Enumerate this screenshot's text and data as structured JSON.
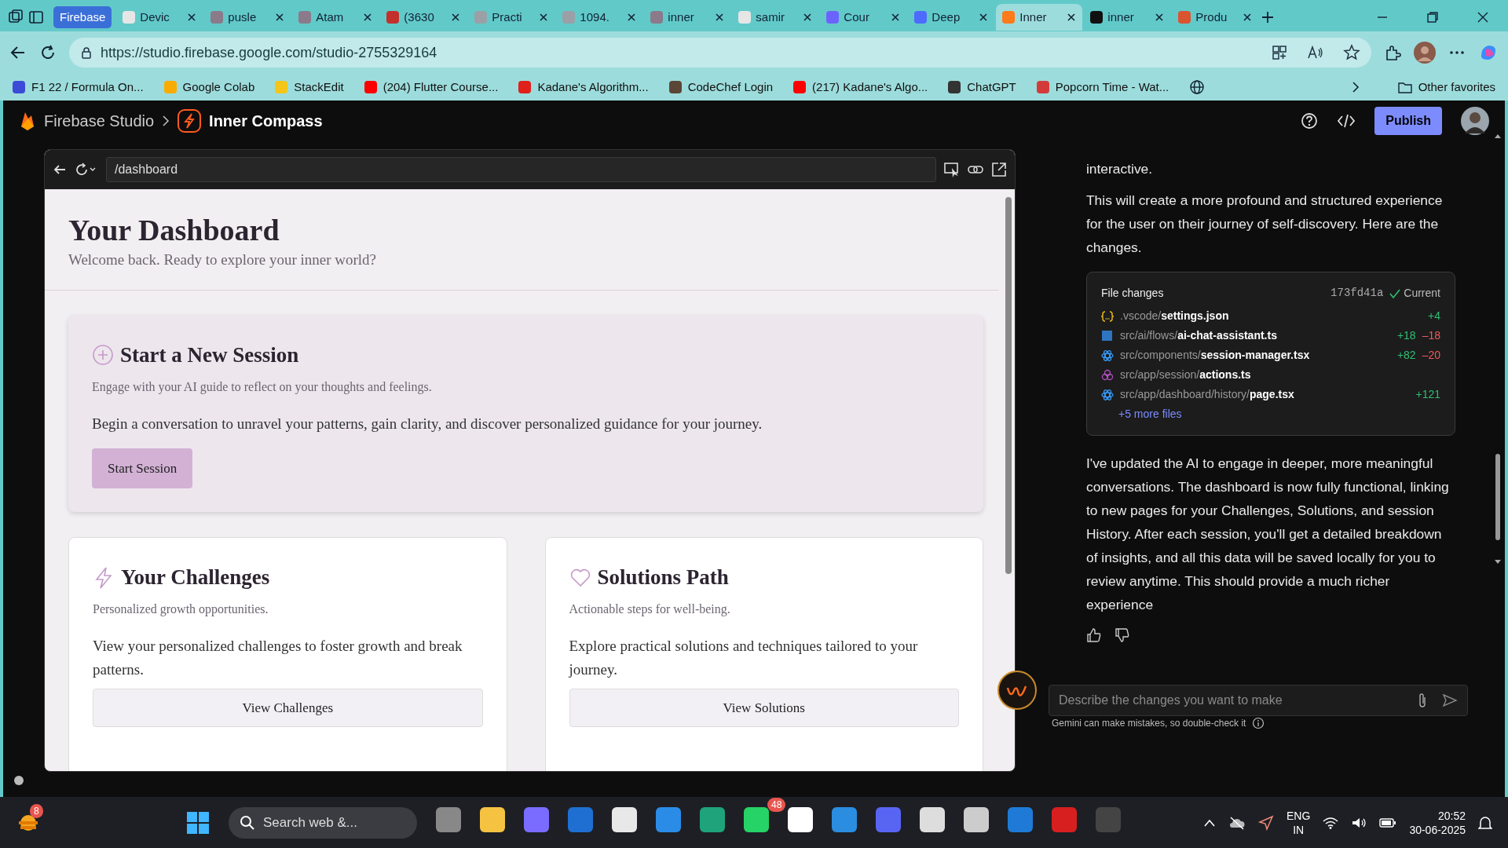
{
  "browser": {
    "tab_group": "Firebase",
    "tabs": [
      {
        "label": "Devic",
        "color": "#e6e6e6",
        "selected": false
      },
      {
        "label": "pusle",
        "color": "#8a7a8a",
        "selected": false
      },
      {
        "label": "Atam",
        "color": "#8a7a8a",
        "selected": false
      },
      {
        "label": "(3630",
        "color": "#c4302b",
        "selected": false
      },
      {
        "label": "Practi",
        "color": "#9aa0a6",
        "selected": false
      },
      {
        "label": "1094.",
        "color": "#9aa0a6",
        "selected": false
      },
      {
        "label": "inner",
        "color": "#8a7a8a",
        "selected": false
      },
      {
        "label": "samir",
        "color": "#e6e6e6",
        "selected": false
      },
      {
        "label": "Cour",
        "color": "#6c63ff",
        "selected": false
      },
      {
        "label": "Deep",
        "color": "#4d6bfe",
        "selected": false
      },
      {
        "label": "Inner",
        "color": "#ff7a1a",
        "selected": true
      },
      {
        "label": "inner",
        "color": "#111111",
        "selected": false
      },
      {
        "label": "Produ",
        "color": "#da552f",
        "selected": false
      }
    ],
    "url": "https://studio.firebase.google.com/studio-2755329164",
    "bookmarks": [
      {
        "label": "F1 22 / Formula On...",
        "color": "#3b4bd8"
      },
      {
        "label": "Google Colab",
        "color": "#f9ab00"
      },
      {
        "label": "StackEdit",
        "color": "#f5c518"
      },
      {
        "label": "(204) Flutter Course...",
        "color": "#ff0000"
      },
      {
        "label": "Kadane's Algorithm...",
        "color": "#e0201b"
      },
      {
        "label": "CodeChef Login",
        "color": "#5b4638"
      },
      {
        "label": "(217) Kadane's Algo...",
        "color": "#ff0000"
      },
      {
        "label": "ChatGPT",
        "color": "#333333"
      },
      {
        "label": "Popcorn Time - Wat...",
        "color": "#d33b3b"
      }
    ],
    "other_favorites": "Other favorites"
  },
  "app": {
    "brand": "Firebase Studio",
    "project": "Inner Compass",
    "publish": "Publish"
  },
  "preview": {
    "path": "/dashboard",
    "title": "Your Dashboard",
    "subtitle": "Welcome back. Ready to explore your inner world?",
    "session": {
      "title": "Start a New Session",
      "subtitle": "Engage with your AI guide to reflect on your thoughts and feelings.",
      "body": "Begin a conversation to unravel your patterns, gain clarity, and discover personalized guidance for your journey.",
      "button": "Start Session"
    },
    "cards": [
      {
        "kind": "bolt",
        "title": "Your Challenges",
        "subtitle": "Personalized growth opportunities.",
        "body": "View your personalized challenges to foster growth and break patterns.",
        "button": "View Challenges"
      },
      {
        "kind": "heart",
        "title": "Solutions Path",
        "subtitle": "Actionable steps for well-being.",
        "body": "Explore practical solutions and techniques tailored to your journey.",
        "button": "View Solutions"
      }
    ]
  },
  "chat": {
    "intro": [
      "interactive.",
      "This will create a more profound and structured experience for the user on their journey of self-discovery. Here are the changes."
    ],
    "file_changes": {
      "title": "File changes",
      "commit": "173fd41a",
      "status": "Current",
      "files": [
        {
          "kind": "json",
          "dir": ".vscode/",
          "file": "settings.json",
          "added": "+4"
        },
        {
          "kind": "ts",
          "dir": "src/ai/flows/",
          "file": "ai-chat-assistant.ts",
          "added": "+18",
          "removed": "–18"
        },
        {
          "kind": "react",
          "dir": "src/components/",
          "file": "session-manager.tsx",
          "added": "+82",
          "removed": "–20"
        },
        {
          "kind": "graphql",
          "dir": "src/app/session/",
          "file": "actions.ts"
        },
        {
          "kind": "react",
          "dir": "src/app/dashboard/history/",
          "file": "page.tsx",
          "added": "+121"
        }
      ],
      "more": "+5 more files"
    },
    "message": "I've updated the AI to engage in deeper, more meaningful conversations. The dashboard is now fully functional, linking to new pages for your Challenges, Solutions, and session History. After each session, you'll get a detailed breakdown of insights, and all this data will be saved locally for you to review anytime. This should provide a much richer experience",
    "input_placeholder": "Describe the changes you want to make",
    "disclaimer": "Gemini can make mistakes, so double-check it"
  },
  "taskbar": {
    "widget_badge": "8",
    "search": "Search web &...",
    "whatsapp_badge": "48",
    "lang": "ENG",
    "region": "IN",
    "time": "20:52",
    "date": "30-06-2025"
  }
}
